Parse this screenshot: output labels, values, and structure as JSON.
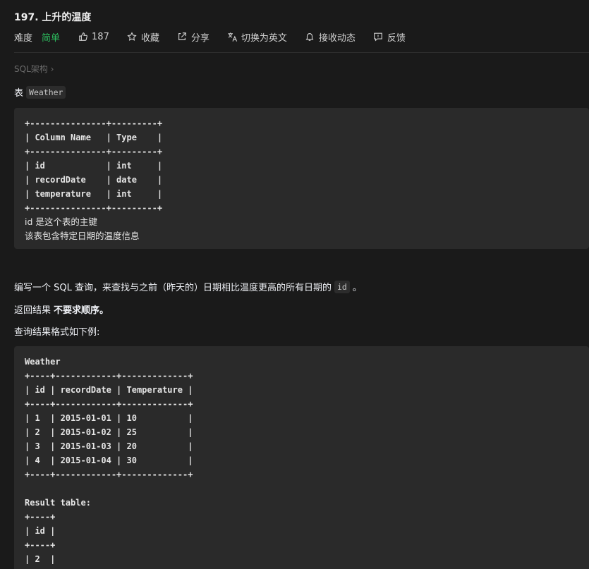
{
  "problem": {
    "title": "197. 上升的温度"
  },
  "toolbar": {
    "difficulty_label": "难度",
    "difficulty_value": "简单",
    "likes": "187",
    "favorite_label": "收藏",
    "share_label": "分享",
    "translate_label": "切换为英文",
    "notify_label": "接收动态",
    "feedback_label": "反馈"
  },
  "breadcrumb": {
    "label": "SQL架构 ›"
  },
  "table_intro": {
    "prefix": "表",
    "table_name": "Weather"
  },
  "schema_block": {
    "lines": [
      "+---------------+---------+",
      "| Column Name   | Type    |",
      "+---------------+---------+",
      "| id            | int     |",
      "| recordDate    | date    |",
      "| temperature   | int     |",
      "+---------------+---------+",
      "id 是这个表的主键",
      "该表包含特定日期的温度信息"
    ]
  },
  "description": {
    "p1_text": "编写一个 SQL 查询，来查找与之前（昨天的）日期相比温度更高的所有日期的",
    "p1_code": "id",
    "p1_end": "。",
    "p2_prefix": "返回结果",
    "p2_bold": "不要求顺序",
    "p2_end": "。",
    "p3_text": "查询结果格式如下例:"
  },
  "example_block": {
    "lines": [
      "Weather",
      "+----+------------+-------------+",
      "| id | recordDate | Temperature |",
      "+----+------------+-------------+",
      "| 1  | 2015-01-01 | 10          |",
      "| 2  | 2015-01-02 | 25          |",
      "| 3  | 2015-01-03 | 20          |",
      "| 4  | 2015-01-04 | 30          |",
      "+----+------------+-------------+",
      "",
      "Result table:",
      "+----+",
      "| id |",
      "+----+",
      "| 2  |",
      "+----+"
    ]
  },
  "colors": {
    "background": "#1a1a1a",
    "code_background": "#2a2a2a",
    "easy_green": "#2cbb5d",
    "text": "#eff1f6",
    "muted": "#6b6b6b"
  }
}
